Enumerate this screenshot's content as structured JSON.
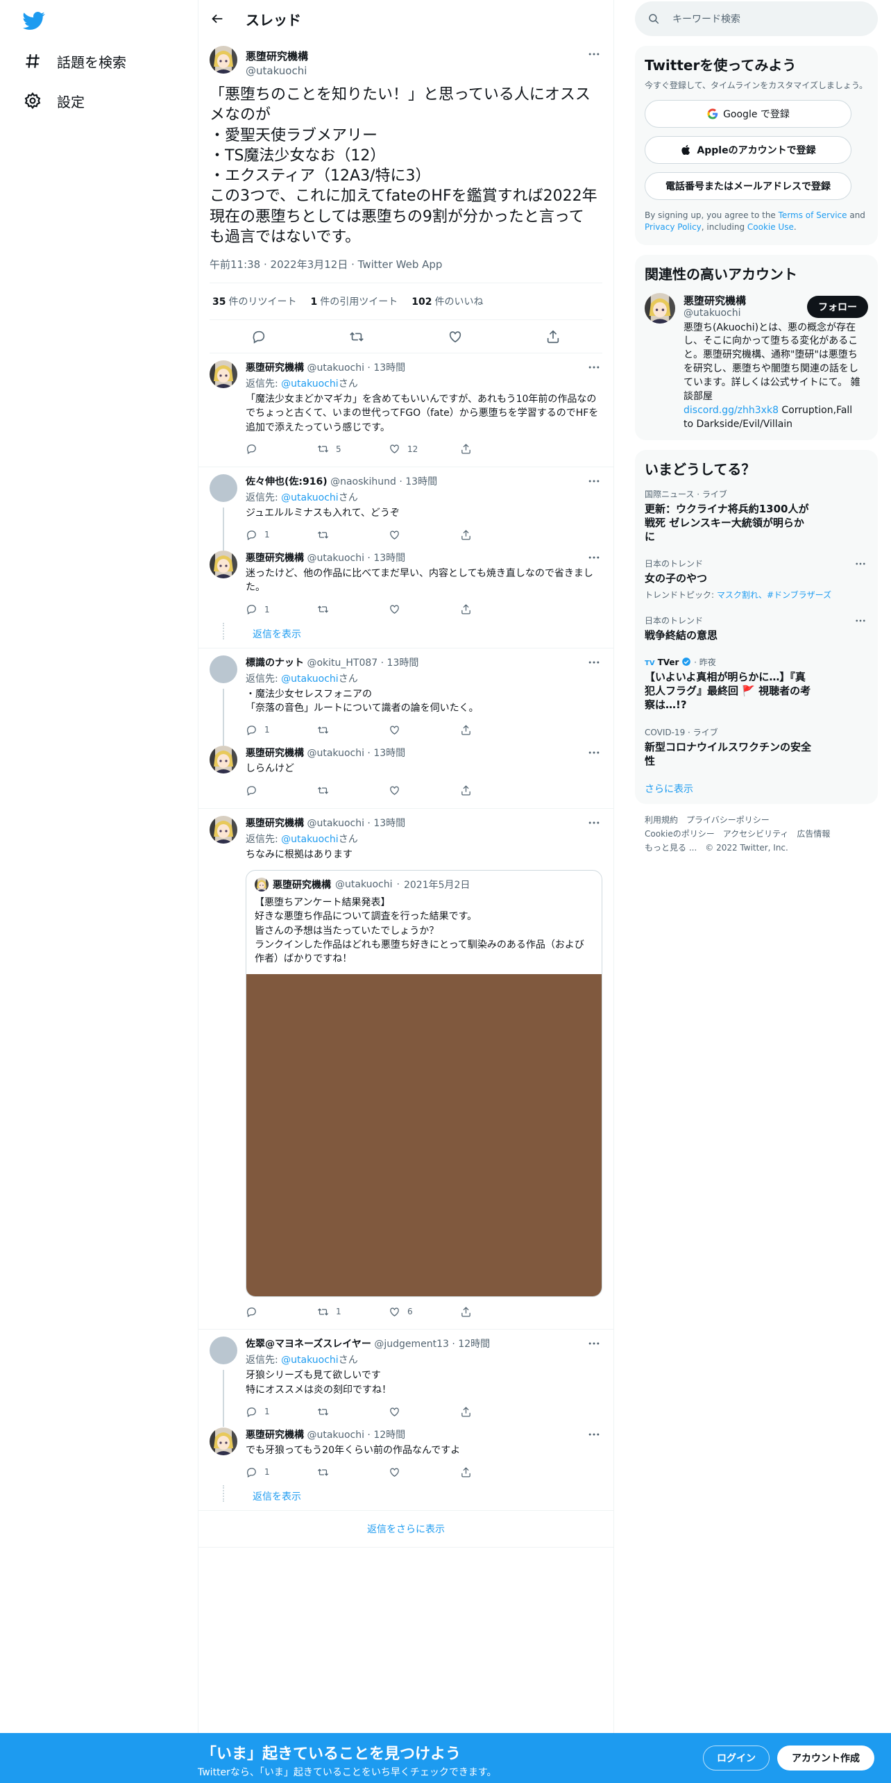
{
  "nav": {
    "explore_label": "話題を検索",
    "settings_label": "設定"
  },
  "header": {
    "title": "スレッド"
  },
  "main_tweet": {
    "name": "悪堕研究機構",
    "handle": "@utakuochi",
    "text": "「悪堕ちのことを知りたい！」と思っている人にオススメなのが\n・愛聖天使ラブメアリー\n・TS魔法少女なお（12）\n・エクスティア（12A3/特に3）\nこの3つで、これに加えてfateのHFを鑑賞すれば2022年現在の悪堕ちとしては悪堕ちの9割が分かったと言っても過言ではないです。",
    "timestamp": "午前11:38 · 2022年3月12日 · Twitter Web App",
    "retweets": "35",
    "retweets_label": "件のリツイート",
    "quotes": "1",
    "quotes_label": "件の引用ツイート",
    "likes": "102",
    "likes_label": "件のいいね"
  },
  "replies": [
    {
      "name": "悪堕研究機構",
      "handle": "@utakuochi",
      "time": "13時間",
      "reply_prefix": "返信先: ",
      "reply_to": "@utakuochi",
      "reply_suffix": "さん",
      "text": "「魔法少女まどかマギカ」を含めてもいいんですが、あれもう10年前の作品なのでちょっと古くて、いまの世代ってFGO（fate）から悪堕ちを学習するのでHFを追加で添えたっていう感じです。",
      "replies": "",
      "retweets": "5",
      "likes": "12"
    },
    {
      "name": "佐々伸也(佐:916)",
      "handle": "@naoskihund",
      "time": "13時間",
      "reply_prefix": "返信先: ",
      "reply_to": "@utakuochi",
      "reply_suffix": "さん",
      "text": "ジュエルルミナスも入れて、どうぞ",
      "replies": "1",
      "retweets": "",
      "likes": ""
    },
    {
      "name": "悪堕研究機構",
      "handle": "@utakuochi",
      "time": "13時間",
      "text": "迷ったけど、他の作品に比べてまだ早い、内容としても焼き直しなので省きました。",
      "replies": "1",
      "retweets": "",
      "likes": ""
    },
    {
      "name": "標識のナット",
      "handle": "@okitu_HT087",
      "time": "13時間",
      "reply_prefix": "返信先: ",
      "reply_to": "@utakuochi",
      "reply_suffix": "さん",
      "text": "・魔法少女セレスフォニアの\n「奈落の音色」ルートについて識者の論を伺いたく。",
      "replies": "1",
      "retweets": "",
      "likes": ""
    },
    {
      "name": "悪堕研究機構",
      "handle": "@utakuochi",
      "time": "13時間",
      "text": "しらんけど",
      "replies": "",
      "retweets": "",
      "likes": ""
    },
    {
      "name": "悪堕研究機構",
      "handle": "@utakuochi",
      "time": "13時間",
      "reply_prefix": "返信先: ",
      "reply_to": "@utakuochi",
      "reply_suffix": "さん",
      "text": "ちなみに根拠はあります",
      "replies": "",
      "retweets": "1",
      "likes": "6"
    },
    {
      "name": "佐翠@マヨネーズスレイヤー",
      "handle": "@judgement13",
      "time": "12時間",
      "reply_prefix": "返信先: ",
      "reply_to": "@utakuochi",
      "reply_suffix": "さん",
      "text": "牙狼シリーズも見て欲しいです\n特にオススメは炎の刻印ですね！",
      "replies": "1",
      "retweets": "",
      "likes": ""
    },
    {
      "name": "悪堕研究機構",
      "handle": "@utakuochi",
      "time": "12時間",
      "text": "でも牙狼ってもう20年くらい前の作品なんですよ",
      "replies": "1",
      "retweets": "",
      "likes": ""
    }
  ],
  "quote": {
    "name": "悪堕研究機構",
    "handle": "@utakuochi",
    "date": "2021年5月2日",
    "text": "【悪堕ちアンケート結果発表】\n好きな悪堕ち作品について調査を行った結果です。\n皆さんの予想は当たっていたでしょうか？\nランクインした作品はどれも悪堕ち好きにとって馴染みのある作品（および作者）ばかりですね！"
  },
  "show_replies_label": "返信を表示",
  "more_replies_label": "返信をさらに表示",
  "dot": " · ",
  "right": {
    "search_placeholder": "キーワード検索",
    "signup": {
      "title": "Twitterを使ってみよう",
      "subtitle": "今すぐ登録して、タイムラインをカスタマイズしましょう。",
      "google_label": "Google で登録",
      "apple_label": "Appleのアカウントで登録",
      "phone_label": "電話番号またはメールアドレスで登録",
      "terms_1": "By signing up, you agree to the ",
      "terms_link1": "Terms of Service",
      "terms_2": " and ",
      "terms_link2": "Privacy Policy",
      "terms_3": ", including ",
      "terms_link3": "Cookie Use",
      "terms_4": "."
    },
    "related": {
      "title": "関連性の高いアカウント",
      "name": "悪堕研究機構",
      "handle": "@utakuochi",
      "follow_label": "フォロー",
      "bio": "悪堕ち(Akuochi)とは、悪の概念が存在し、そこに向かって堕ちる変化があること。悪堕研究機構、通称\"堕研\"は悪堕ちを研究し、悪堕ちや闇堕ち関連の話をしています。詳しくは公式サイトにて。 雑談部屋",
      "bio_link": "discord.gg/zhh3xk8",
      "bio_tail": " Corruption,Fall to Darkside/Evil/Villain"
    },
    "trends": {
      "title": "いまどうしてる？",
      "items": [
        {
          "context": "国際ニュース · ライブ",
          "title": "更新：ウクライナ将兵約1300人が戦死 ゼレンスキー大統領が明らかに",
          "topic": ""
        },
        {
          "context": "日本のトレンド",
          "title": "女の子のやつ",
          "topic_prefix": "トレンドトピック: ",
          "topic": "マスク割れ、#ドンブラザーズ"
        },
        {
          "context": "日本のトレンド",
          "title": "戦争終結の意思",
          "topic": ""
        },
        {
          "context": "TVer",
          "context_suffix": " · 昨夜",
          "title": "【いよいよ真相が明らかに…】『真犯人フラグ』最終回 🚩 視聴者の考察は…!?",
          "topic": ""
        },
        {
          "context": "COVID-19 · ライブ",
          "title": "新型コロナウイルスワクチンの安全性",
          "topic": ""
        }
      ],
      "show_more": "さらに表示"
    },
    "footer": {
      "line1": [
        "利用規約",
        "プライバシーポリシー"
      ],
      "line2": [
        "Cookieのポリシー",
        "アクセシビリティ",
        "広告情報"
      ],
      "line3": [
        "もっと見る ...",
        "© 2022 Twitter, Inc."
      ]
    }
  },
  "bottom": {
    "headline": "「いま」起きていることを見つけよう",
    "sub": "Twitterなら、「いま」起きていることをいち早くチェックできます。",
    "login_label": "ログイン",
    "signup_label": "アカウント作成"
  },
  "colors": {
    "accent": "#1d9bf0",
    "text": "#0f1419",
    "muted": "#536471",
    "quote_image": "#80593e"
  }
}
